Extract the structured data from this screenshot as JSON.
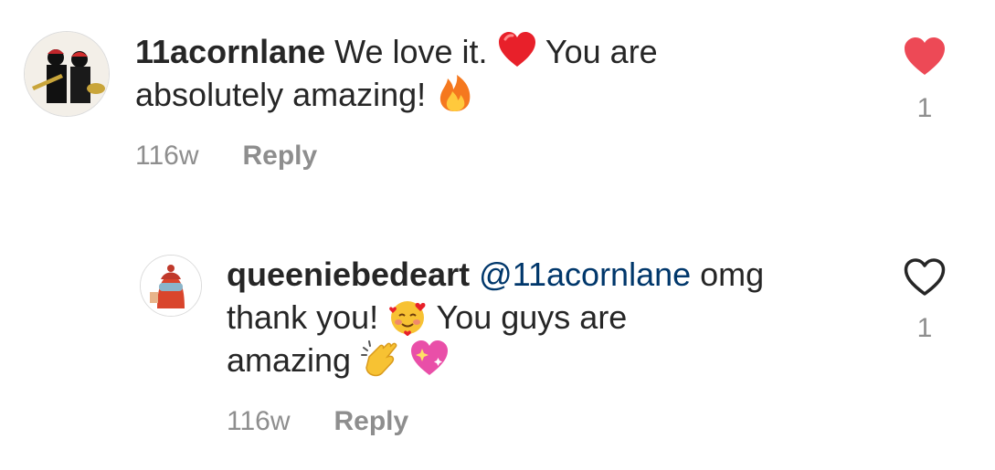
{
  "comments": [
    {
      "username": "11acornlane",
      "text_part1": "We love it.",
      "text_part2": "You are",
      "text_line2": "absolutely amazing!",
      "emojis": [
        "red-heart-emoji",
        "fire-emoji"
      ],
      "time": "116w",
      "reply_label": "Reply",
      "like_count": "1",
      "liked": true
    },
    {
      "username": "queeniebedeart",
      "mention": "@11acornlane",
      "text_part1": "omg",
      "text_line2a": "thank you!",
      "text_line2b": "You guys are",
      "text_line3": "amazing",
      "emojis": [
        "smiling-face-with-hearts-emoji",
        "clapping-hands-emoji",
        "sparkling-heart-emoji"
      ],
      "time": "116w",
      "reply_label": "Reply",
      "like_count": "1",
      "liked": false
    }
  ],
  "colors": {
    "like_active": "#ed4956",
    "mention": "#00376b",
    "meta": "#8e8e8e",
    "text": "#262626"
  }
}
